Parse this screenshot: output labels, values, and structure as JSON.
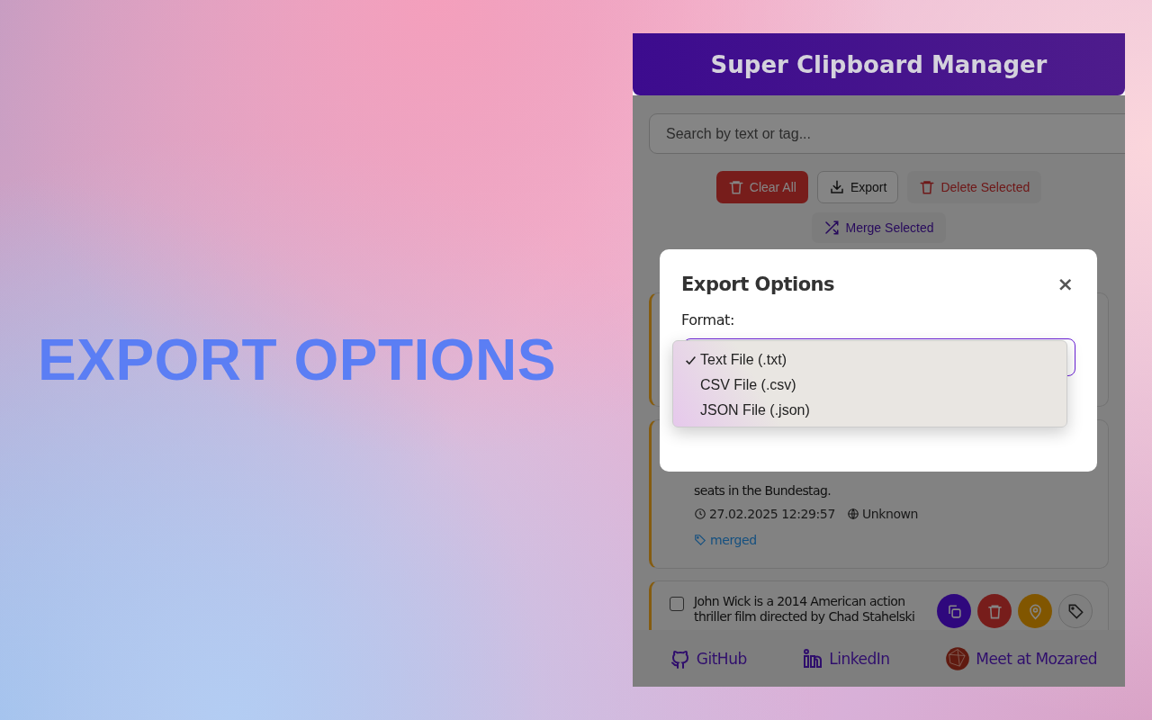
{
  "page_heading": "EXPORT OPTIONS",
  "header": {
    "title": "Super Clipboard Manager"
  },
  "search": {
    "placeholder": "Search by text or tag..."
  },
  "toolbar": [
    {
      "kind": "danger",
      "label": "Clear All"
    },
    {
      "kind": "outline",
      "label": "Export"
    },
    {
      "kind": "soft-danger",
      "label": "Delete Selected"
    },
    {
      "kind": "soft-primary",
      "label": "Merge Selected"
    }
  ],
  "clips": [
    {
      "lines": [
        "seats in the Bundestag."
      ],
      "time": "27.02.2025 12:29:57",
      "source": "Unknown",
      "tags": [
        "merged"
      ]
    },
    {
      "checked": false,
      "lines": [
        "John Wick is a 2014 American action",
        "thriller film directed by Chad Stahelski"
      ]
    }
  ],
  "footer": [
    {
      "kind": "github",
      "label": "GitHub"
    },
    {
      "kind": "linkedin",
      "label": "LinkedIn"
    },
    {
      "kind": "mozared",
      "label": "Meet at Mozared"
    }
  ],
  "modal": {
    "title": "Export Options",
    "close": "×",
    "format_label": "Format:",
    "options": [
      {
        "label": "Text File (.txt)",
        "selected": true
      },
      {
        "label": "CSV File (.csv)",
        "selected": false
      },
      {
        "label": "JSON File (.json)",
        "selected": false
      }
    ]
  }
}
